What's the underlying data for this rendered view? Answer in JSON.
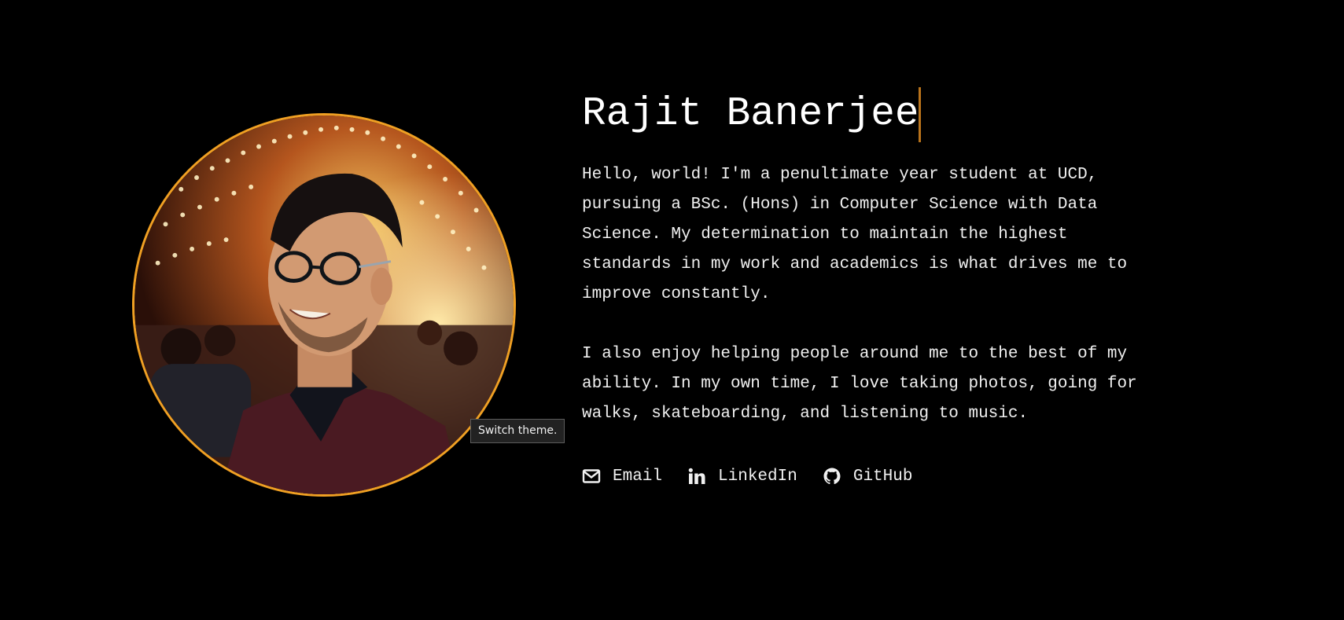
{
  "profile": {
    "name": "Rajit Banerjee",
    "avatar_alt": "portrait-photo",
    "tooltip": "Switch theme."
  },
  "bio": {
    "paragraph_1": "Hello, world! I'm a penultimate year student at UCD, pursuing a BSc. (Hons) in Computer Science with Data Science. My determination to maintain the highest standards in my work and academics is what drives me to improve constantly.",
    "paragraph_2": "I also enjoy helping people around me to the best of my ability. In my own time, I love taking photos, going for walks, skateboarding, and listening to music."
  },
  "links": [
    {
      "label": "Email",
      "icon": "envelope-icon"
    },
    {
      "label": "LinkedIn",
      "icon": "linkedin-icon"
    },
    {
      "label": "GitHub",
      "icon": "github-icon"
    }
  ],
  "colors": {
    "background": "#000000",
    "accent": "#f0a023",
    "caret": "#b8731b",
    "text": "#f0f0f0"
  }
}
